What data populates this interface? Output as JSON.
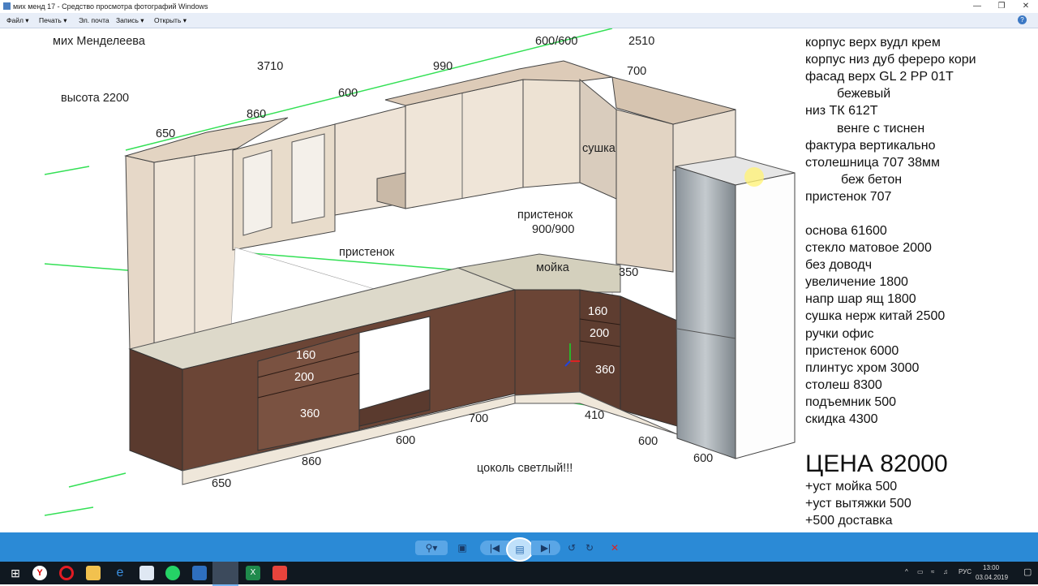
{
  "window": {
    "title": "мих менд 17 - Средство просмотра фотографий Windows"
  },
  "menu": [
    {
      "label": "Файл ▾"
    },
    {
      "label": "Печать ▾"
    },
    {
      "label": "Эл. почта"
    },
    {
      "label": "Запись ▾"
    },
    {
      "label": "Открыть ▾"
    }
  ],
  "photo": {
    "client": "мих Менделеева",
    "height_note": "высота 2200",
    "dims": {
      "d3710": "3710",
      "d990": "990",
      "d600600": "600/600",
      "d2510": "2510",
      "d700a": "700",
      "d600a": "600",
      "d860a": "860",
      "d650a": "650",
      "s160a": "160",
      "s200a": "200",
      "s360a": "360",
      "s160b": "160",
      "s200b": "200",
      "s360b": "360",
      "d350": "350",
      "b700": "700",
      "b410": "410",
      "b600a": "600",
      "b860": "860",
      "b650": "650",
      "b600b": "600",
      "b600c": "600"
    },
    "labels": {
      "sushka": "сушка",
      "pristenok1": "пристенок",
      "pristenok2": "пристенок",
      "pristenok2_size": "900/900",
      "moyka": "мойка",
      "tsokol": "цоколь светлый!!!"
    },
    "notes": [
      "корпус верх вудл крем",
      "корпус низ дуб фереро кори",
      "фасад верх GL 2 PP 01T",
      "бежевый",
      "низ ТК 612Т",
      "венге с тиснен",
      "фактура вертикально",
      "столешница 707 38мм",
      "беж бетон",
      "пристенок 707",
      "основа 61600",
      "стекло матовое 2000",
      "без доводч",
      "увеличение 1800",
      "напр шар ящ 1800",
      "сушка нерж китай 2500",
      "ручки офис",
      "пристенок 6000",
      "плинтус хром 3000",
      "столеш 8300",
      "подъемник 500",
      "скидка 4300"
    ],
    "price": "ЦЕНА 82000",
    "extras": [
      "+уст мойка 500",
      "+уст вытяжки 500",
      "+500 доставка"
    ]
  },
  "taskbar": {
    "lang": "РУС",
    "time": "13:00",
    "date": "03.04.2019"
  }
}
